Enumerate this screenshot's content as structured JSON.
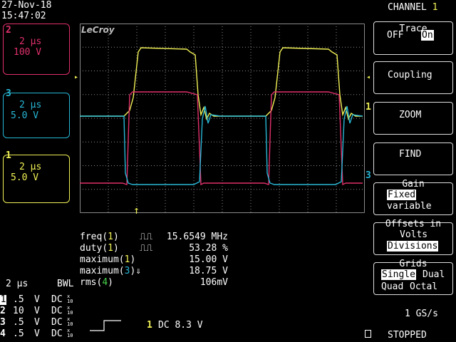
{
  "header": {
    "date": "27-Nov-18",
    "time": "15:47:02"
  },
  "brand": "LeCroy",
  "channels": [
    {
      "id": "2",
      "timebase": "2 µs",
      "scale": "100 V",
      "color": "#e0306a"
    },
    {
      "id": "3",
      "timebase": "2 µs",
      "scale": "5.0 V",
      "color": "#27b7d6"
    },
    {
      "id": "1",
      "timebase": "2 µs",
      "scale": "5.0 V",
      "color": "#f1f156"
    }
  ],
  "right_markers": {
    "ch1": "1",
    "ch3": "3"
  },
  "menu": {
    "title": "CHANNEL",
    "title_ch": "1",
    "trace": {
      "label": "Trace",
      "off": "OFF",
      "on": "On"
    },
    "coupling": "Coupling",
    "zoom": "ZOOM",
    "find": "FIND",
    "gain": {
      "label": "Gain",
      "fixed": "Fixed",
      "variable": "variable"
    },
    "offsets": {
      "label": "Offsets in",
      "volts": "Volts",
      "divisions": "Divisions"
    },
    "grids": {
      "label": "Grids",
      "single": "Single",
      "dual": "Dual",
      "quad": "Quad",
      "octal": "Octal"
    }
  },
  "measurements": [
    {
      "name": "freq",
      "ch": "1",
      "sym": "⎍⎍",
      "value": "15.6549 MHz"
    },
    {
      "name": "duty",
      "ch": "1",
      "sym": "⎍⎍",
      "value": "53.28 %"
    },
    {
      "name": "maximum",
      "ch": "1",
      "sym": "",
      "value": "15.00 V"
    },
    {
      "name": "maximum",
      "ch": "3",
      "sym": "⇓",
      "value": "18.75 V"
    },
    {
      "name": "rms",
      "ch": "4",
      "sym": "",
      "value": "106mV"
    }
  ],
  "bottom": {
    "timebase": "2 µs",
    "bwl": "BWL",
    "rows": [
      {
        "ch": "1",
        "v": ".5",
        "unit": "V",
        "coupling": "DC"
      },
      {
        "ch": "2",
        "v": "10",
        "unit": "V",
        "coupling": "DC"
      },
      {
        "ch": "3",
        "v": ".5",
        "unit": "V",
        "coupling": "DC"
      },
      {
        "ch": "4",
        "v": ".5",
        "unit": "V",
        "coupling": "DC"
      }
    ],
    "trigger": {
      "ch": "1",
      "text": "DC 8.3 V"
    },
    "sample_rate": "1 GS/s",
    "status": "STOPPED"
  },
  "colors": {
    "ch1": "#f1f156",
    "ch2": "#e0306a",
    "ch3": "#27b7d6",
    "ch4": "#47d64a",
    "grid": "#8a8a8a"
  }
}
